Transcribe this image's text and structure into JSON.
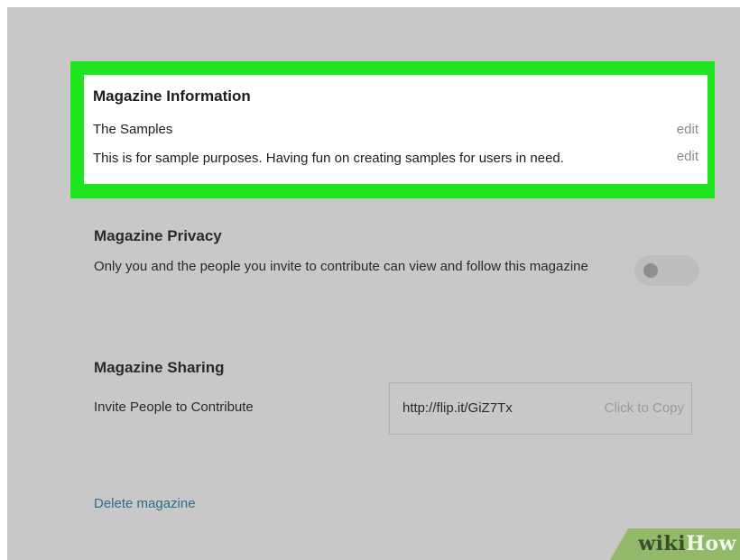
{
  "magazine_information": {
    "title": "Magazine Information",
    "name": "The Samples",
    "description": "This is for sample purposes. Having fun on creating samples for users in need.",
    "edit_label": "edit"
  },
  "magazine_privacy": {
    "title": "Magazine Privacy",
    "description": "Only you and the people you invite to contribute can view and follow this magazine",
    "toggle_on": false
  },
  "magazine_sharing": {
    "title": "Magazine Sharing",
    "invite_label": "Invite People to Contribute",
    "share_url": "http://flip.it/GiZ7Tx",
    "copy_label": "Click to Copy"
  },
  "delete_label": "Delete magazine",
  "watermark": {
    "wiki": "wiki",
    "how": "How"
  },
  "colors": {
    "highlight": "#1fe51f",
    "background": "#c8c8c8",
    "link": "#2f6b8c"
  }
}
